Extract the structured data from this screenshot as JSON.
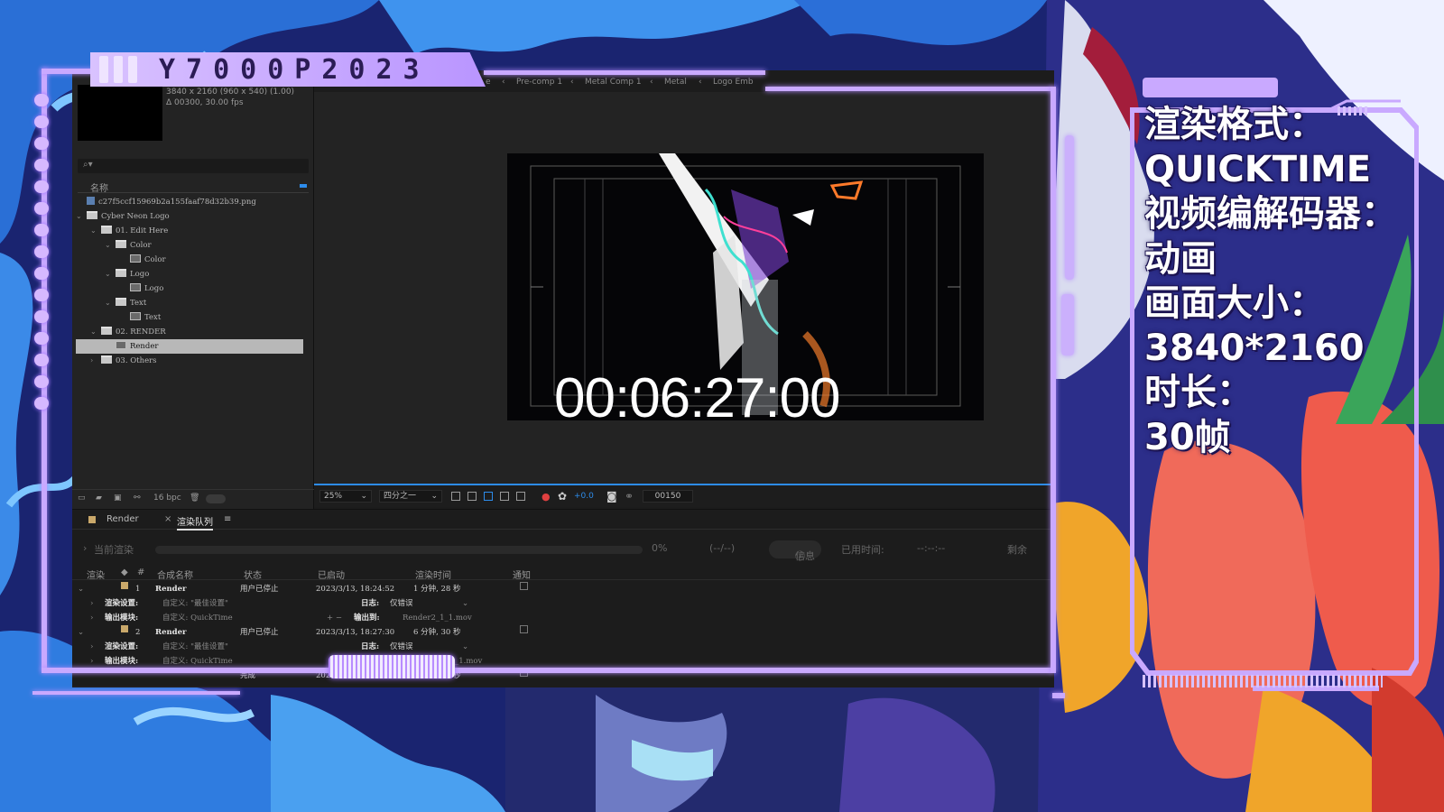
{
  "overlay": {
    "title": "Y7000P2023",
    "info_lines": [
      "渲染格式：",
      "QUICKTIME",
      "视频编解码器：",
      "动画",
      "画面大小：",
      "3840*2160",
      "时长：",
      "30帧"
    ]
  },
  "project_panel": {
    "comp_size": "3840 x 2160  (960 x 540) (1.00)",
    "comp_duration": "Δ 00300, 30.00 fps",
    "search_placeholder": "",
    "column_name": "名称",
    "bit_depth": "16 bpc",
    "items": [
      {
        "label": "c27f5ccf15969b2a155faaf78d32b39.png",
        "type": "file",
        "level": 0,
        "chevron": ""
      },
      {
        "label": "Cyber Neon Logo",
        "type": "folder",
        "level": 0,
        "chevron": "v"
      },
      {
        "label": "01. Edit Here",
        "type": "folder",
        "level": 1,
        "chevron": "v"
      },
      {
        "label": "Color",
        "type": "folder",
        "level": 2,
        "chevron": "v"
      },
      {
        "label": "Color",
        "type": "comp",
        "level": 3,
        "chevron": ""
      },
      {
        "label": "Logo",
        "type": "folder",
        "level": 2,
        "chevron": "v"
      },
      {
        "label": "Logo",
        "type": "comp",
        "level": 3,
        "chevron": ""
      },
      {
        "label": "Text",
        "type": "folder",
        "level": 2,
        "chevron": "v"
      },
      {
        "label": "Text",
        "type": "comp",
        "level": 3,
        "chevron": ""
      },
      {
        "label": "02. RENDER",
        "type": "folder",
        "level": 1,
        "chevron": "v"
      },
      {
        "label": "Render",
        "type": "comp",
        "level": 2,
        "chevron": "",
        "selected": true
      },
      {
        "label": "03. Others",
        "type": "folder",
        "level": 1,
        "chevron": ">"
      }
    ]
  },
  "composition": {
    "breadcrumbs": [
      "e",
      "Pre-comp 1",
      "Metal Comp 1",
      "Metal",
      "Logo Emb"
    ],
    "timecode_overlay": "00:06:27:00",
    "zoom": "25%",
    "resolution": "四分之一",
    "exposure": "+0.0",
    "current_frame": "00150"
  },
  "render_queue": {
    "tab_comp": "Render",
    "tab_queue": "渲染队列",
    "current_render_label": "当前渲染",
    "percent": "0%",
    "time_placeholder": "(--/--)",
    "info_button": "信息",
    "elapsed_label": "已用时间:",
    "elapsed_value": "--:--:--",
    "remaining_label": "剩余",
    "headers": [
      "渲染",
      "#",
      "合成名称",
      "状态",
      "已启动",
      "渲染时间",
      "通知"
    ],
    "items": [
      {
        "index": "1",
        "comp": "Render",
        "status": "用户已停止",
        "started": "2023/3/13, 18:24:52",
        "duration": "1 分钟, 28 秒",
        "settings_label": "渲染设置:",
        "settings_value": "自定义: \"最佳设置\"",
        "log_label": "日志:",
        "log_value": "仅错误",
        "output_label": "输出模块:",
        "output_value": "自定义: QuickTime",
        "output_to_label": "输出到:",
        "output_to_value": "Render2_1_1.mov"
      },
      {
        "index": "2",
        "comp": "Render",
        "status": "用户已停止",
        "started": "2023/3/13, 18:27:30",
        "duration": "6 分钟, 30 秒",
        "settings_label": "渲染设置:",
        "settings_value": "自定义: \"最佳设置\"",
        "log_label": "日志:",
        "log_value": "仅错误",
        "output_label": "输出模块:",
        "output_value": "自定义: QuickTime",
        "output_to_value": "_1.mov"
      },
      {
        "status": "完成",
        "started": "2023/4/20, 17:52:52",
        "duration": "6 分钟, 27 秒"
      }
    ]
  },
  "colors": {
    "frame_lavender": "#c9a9ff",
    "accent_blue": "#2d8ceb",
    "background_navy": "#1d2a7a"
  }
}
